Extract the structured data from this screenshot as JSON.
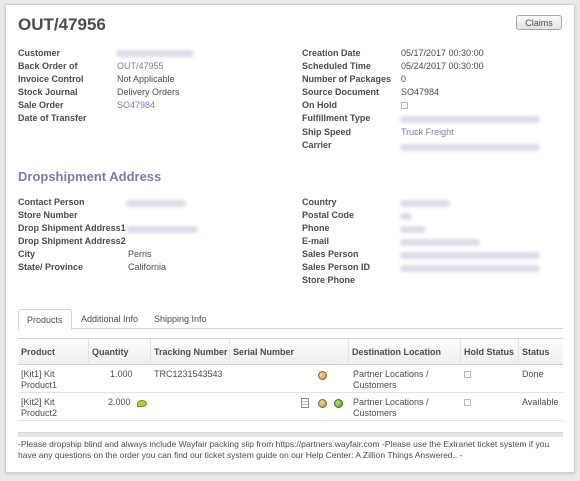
{
  "header": {
    "title": "OUT/47956",
    "claims_label": "Claims"
  },
  "left_fields": [
    {
      "label": "Customer",
      "value": "",
      "kind": "blur"
    },
    {
      "label": "Back Order of",
      "value": "OUT/47955",
      "kind": "link"
    },
    {
      "label": "Invoice Control",
      "value": "Not Applicable",
      "kind": "text"
    },
    {
      "label": "Stock Journal",
      "value": "Delivery Orders",
      "kind": "text"
    },
    {
      "label": "Sale Order",
      "value": "SO47984",
      "kind": "link"
    },
    {
      "label": "Date of Transfer",
      "value": "",
      "kind": "empty"
    }
  ],
  "right_fields": [
    {
      "label": "Creation Date",
      "value": "05/17/2017 00:30:00",
      "kind": "text"
    },
    {
      "label": "Scheduled Time",
      "value": "05/24/2017 00:30:00",
      "kind": "text"
    },
    {
      "label": "Number of Packages",
      "value": "0",
      "kind": "text"
    },
    {
      "label": "Source Document",
      "value": "SO47984",
      "kind": "text"
    },
    {
      "label": "On Hold",
      "value": "",
      "kind": "checkbox"
    },
    {
      "label": "Fulfillment Type",
      "value": "",
      "kind": "blur"
    },
    {
      "label": "Ship Speed",
      "value": "Truck Freight",
      "kind": "link"
    },
    {
      "label": "Carrier",
      "value": "",
      "kind": "blur"
    }
  ],
  "dropship": {
    "title": "Dropshipment Address",
    "left_fields": [
      {
        "label": "Contact Person",
        "value": "",
        "kind": "blur"
      },
      {
        "label": "Store Number",
        "value": "",
        "kind": "empty"
      },
      {
        "label": "Drop Shipment Address1",
        "value": "",
        "kind": "blur"
      },
      {
        "label": "Drop Shipment Address2",
        "value": "",
        "kind": "empty"
      },
      {
        "label": "City",
        "value": "Perris",
        "kind": "text"
      },
      {
        "label": "State/ Province",
        "value": "California",
        "kind": "text"
      }
    ],
    "right_fields": [
      {
        "label": "Country",
        "value": "",
        "kind": "blur"
      },
      {
        "label": "Postal Code",
        "value": "",
        "kind": "blur"
      },
      {
        "label": "Phone",
        "value": "",
        "kind": "blur"
      },
      {
        "label": "E-mail",
        "value": "",
        "kind": "blur"
      },
      {
        "label": "Sales Person",
        "value": "",
        "kind": "blur"
      },
      {
        "label": "Sales Person ID",
        "value": "",
        "kind": "blur"
      },
      {
        "label": "Store Phone",
        "value": "",
        "kind": "empty"
      }
    ]
  },
  "tabs": [
    {
      "label": "Products",
      "active": true
    },
    {
      "label": "Additional Info",
      "active": false
    },
    {
      "label": "Shipping Info",
      "active": false
    }
  ],
  "products_table": {
    "columns": [
      "Product",
      "Quantity",
      "Tracking Number",
      "Serial Number",
      "Destination Location",
      "Hold Status",
      "Status"
    ],
    "rows": [
      {
        "product": "[Kit1] Kit Product1",
        "quantity": "1.000",
        "tracking": "TRC1231543543",
        "serial": "",
        "destination": "Partner Locations / Customers",
        "hold": false,
        "status": "Done"
      },
      {
        "product": "[Kit2] Kit Product2",
        "quantity": "2.000",
        "tracking": "",
        "serial": "",
        "destination": "Partner Locations / Customers",
        "hold": false,
        "status": "Available"
      }
    ]
  },
  "notes": "-Please dropship blind and always include Wayfair packing slip from https://partners.wayfair.com -Please use the Extranet ticket system if you have any questions on the order you can find our ticket system guide on our Help Center: A Zillion Things Answered..  -"
}
